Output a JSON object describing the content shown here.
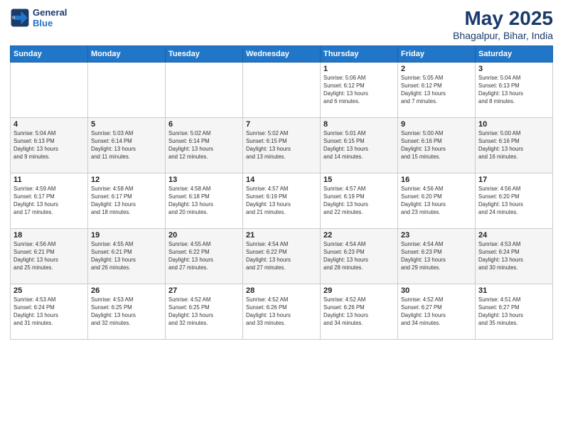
{
  "header": {
    "logo_line1": "General",
    "logo_line2": "Blue",
    "month": "May 2025",
    "location": "Bhagalpur, Bihar, India"
  },
  "weekdays": [
    "Sunday",
    "Monday",
    "Tuesday",
    "Wednesday",
    "Thursday",
    "Friday",
    "Saturday"
  ],
  "weeks": [
    [
      {
        "day": "",
        "info": ""
      },
      {
        "day": "",
        "info": ""
      },
      {
        "day": "",
        "info": ""
      },
      {
        "day": "",
        "info": ""
      },
      {
        "day": "1",
        "info": "Sunrise: 5:06 AM\nSunset: 6:12 PM\nDaylight: 13 hours\nand 6 minutes."
      },
      {
        "day": "2",
        "info": "Sunrise: 5:05 AM\nSunset: 6:12 PM\nDaylight: 13 hours\nand 7 minutes."
      },
      {
        "day": "3",
        "info": "Sunrise: 5:04 AM\nSunset: 6:13 PM\nDaylight: 13 hours\nand 8 minutes."
      }
    ],
    [
      {
        "day": "4",
        "info": "Sunrise: 5:04 AM\nSunset: 6:13 PM\nDaylight: 13 hours\nand 9 minutes."
      },
      {
        "day": "5",
        "info": "Sunrise: 5:03 AM\nSunset: 6:14 PM\nDaylight: 13 hours\nand 11 minutes."
      },
      {
        "day": "6",
        "info": "Sunrise: 5:02 AM\nSunset: 6:14 PM\nDaylight: 13 hours\nand 12 minutes."
      },
      {
        "day": "7",
        "info": "Sunrise: 5:02 AM\nSunset: 6:15 PM\nDaylight: 13 hours\nand 13 minutes."
      },
      {
        "day": "8",
        "info": "Sunrise: 5:01 AM\nSunset: 6:15 PM\nDaylight: 13 hours\nand 14 minutes."
      },
      {
        "day": "9",
        "info": "Sunrise: 5:00 AM\nSunset: 6:16 PM\nDaylight: 13 hours\nand 15 minutes."
      },
      {
        "day": "10",
        "info": "Sunrise: 5:00 AM\nSunset: 6:16 PM\nDaylight: 13 hours\nand 16 minutes."
      }
    ],
    [
      {
        "day": "11",
        "info": "Sunrise: 4:59 AM\nSunset: 6:17 PM\nDaylight: 13 hours\nand 17 minutes."
      },
      {
        "day": "12",
        "info": "Sunrise: 4:58 AM\nSunset: 6:17 PM\nDaylight: 13 hours\nand 18 minutes."
      },
      {
        "day": "13",
        "info": "Sunrise: 4:58 AM\nSunset: 6:18 PM\nDaylight: 13 hours\nand 20 minutes."
      },
      {
        "day": "14",
        "info": "Sunrise: 4:57 AM\nSunset: 6:19 PM\nDaylight: 13 hours\nand 21 minutes."
      },
      {
        "day": "15",
        "info": "Sunrise: 4:57 AM\nSunset: 6:19 PM\nDaylight: 13 hours\nand 22 minutes."
      },
      {
        "day": "16",
        "info": "Sunrise: 4:56 AM\nSunset: 6:20 PM\nDaylight: 13 hours\nand 23 minutes."
      },
      {
        "day": "17",
        "info": "Sunrise: 4:56 AM\nSunset: 6:20 PM\nDaylight: 13 hours\nand 24 minutes."
      }
    ],
    [
      {
        "day": "18",
        "info": "Sunrise: 4:56 AM\nSunset: 6:21 PM\nDaylight: 13 hours\nand 25 minutes."
      },
      {
        "day": "19",
        "info": "Sunrise: 4:55 AM\nSunset: 6:21 PM\nDaylight: 13 hours\nand 26 minutes."
      },
      {
        "day": "20",
        "info": "Sunrise: 4:55 AM\nSunset: 6:22 PM\nDaylight: 13 hours\nand 27 minutes."
      },
      {
        "day": "21",
        "info": "Sunrise: 4:54 AM\nSunset: 6:22 PM\nDaylight: 13 hours\nand 27 minutes."
      },
      {
        "day": "22",
        "info": "Sunrise: 4:54 AM\nSunset: 6:23 PM\nDaylight: 13 hours\nand 28 minutes."
      },
      {
        "day": "23",
        "info": "Sunrise: 4:54 AM\nSunset: 6:23 PM\nDaylight: 13 hours\nand 29 minutes."
      },
      {
        "day": "24",
        "info": "Sunrise: 4:53 AM\nSunset: 6:24 PM\nDaylight: 13 hours\nand 30 minutes."
      }
    ],
    [
      {
        "day": "25",
        "info": "Sunrise: 4:53 AM\nSunset: 6:24 PM\nDaylight: 13 hours\nand 31 minutes."
      },
      {
        "day": "26",
        "info": "Sunrise: 4:53 AM\nSunset: 6:25 PM\nDaylight: 13 hours\nand 32 minutes."
      },
      {
        "day": "27",
        "info": "Sunrise: 4:52 AM\nSunset: 6:25 PM\nDaylight: 13 hours\nand 32 minutes."
      },
      {
        "day": "28",
        "info": "Sunrise: 4:52 AM\nSunset: 6:26 PM\nDaylight: 13 hours\nand 33 minutes."
      },
      {
        "day": "29",
        "info": "Sunrise: 4:52 AM\nSunset: 6:26 PM\nDaylight: 13 hours\nand 34 minutes."
      },
      {
        "day": "30",
        "info": "Sunrise: 4:52 AM\nSunset: 6:27 PM\nDaylight: 13 hours\nand 34 minutes."
      },
      {
        "day": "31",
        "info": "Sunrise: 4:51 AM\nSunset: 6:27 PM\nDaylight: 13 hours\nand 35 minutes."
      }
    ]
  ]
}
